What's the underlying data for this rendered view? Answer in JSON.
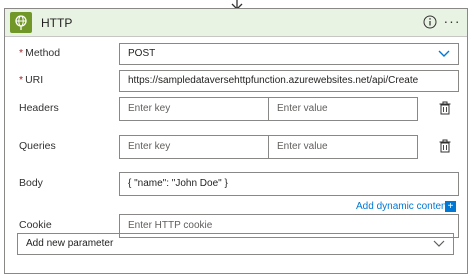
{
  "header": {
    "title": "HTTP"
  },
  "fields": {
    "method": {
      "label": "Method",
      "required_mark": "*",
      "value": "POST"
    },
    "uri": {
      "label": "URI",
      "required_mark": "*",
      "value": "https://sampledataversehttpfunction.azurewebsites.net/api/Create"
    },
    "headers": {
      "label": "Headers",
      "key_placeholder": "Enter key",
      "value_placeholder": "Enter value"
    },
    "queries": {
      "label": "Queries",
      "key_placeholder": "Enter key",
      "value_placeholder": "Enter value"
    },
    "body": {
      "label": "Body",
      "value": "{  \"name\": \"John Doe\" }"
    },
    "add_dynamic_content": "Add dynamic content",
    "dynamic_plus": "+",
    "cookie": {
      "label": "Cookie",
      "placeholder": "Enter HTTP cookie"
    }
  },
  "add_parameter": {
    "label": "Add new parameter"
  },
  "colors": {
    "accent": "#0078d4",
    "header_bg": "#e9f3e4",
    "icon_bg": "#709727",
    "required": "#a4262c"
  }
}
